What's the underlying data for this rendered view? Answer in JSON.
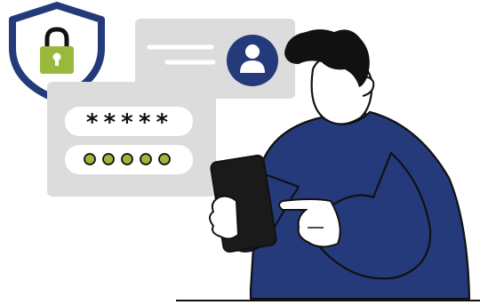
{
  "illustration": {
    "login_card": {
      "password_mask": "*****",
      "pin_dot_count": 5
    }
  },
  "icons": {
    "shield": "shield-padlock-icon",
    "profile": "user-avatar-icon",
    "device": "tablet-icon"
  },
  "colors": {
    "navy": "#243a7a",
    "lime": "#99b83c",
    "card_gray": "#dcdcdc",
    "outline": "#111111"
  }
}
